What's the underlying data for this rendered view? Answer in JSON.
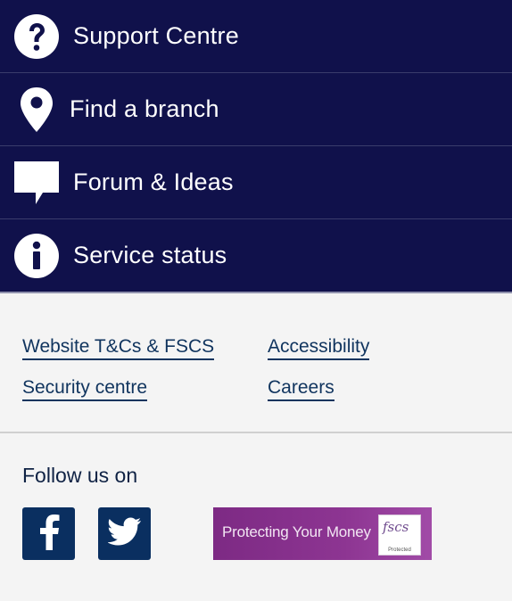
{
  "menu": {
    "items": [
      {
        "label": "Support Centre",
        "icon": "question-circle-icon"
      },
      {
        "label": "Find a branch",
        "icon": "map-pin-icon"
      },
      {
        "label": "Forum & Ideas",
        "icon": "speech-bubble-icon"
      },
      {
        "label": "Service status",
        "icon": "info-circle-icon"
      }
    ]
  },
  "footer_links": {
    "website_tcs": "Website T&Cs & FSCS",
    "accessibility": "Accessibility",
    "security_centre": "Security centre",
    "careers": "Careers"
  },
  "follow": {
    "title": "Follow us on",
    "facebook_icon": "facebook-icon",
    "twitter_icon": "twitter-icon"
  },
  "fscs_banner": {
    "text": "Protecting Your Money",
    "logo": "fscs",
    "sub": "Protected"
  },
  "colors": {
    "menu_background": "#10114b",
    "link": "#10345e",
    "social_background": "#0a2f60",
    "fscs_purple": "#8d3592"
  }
}
